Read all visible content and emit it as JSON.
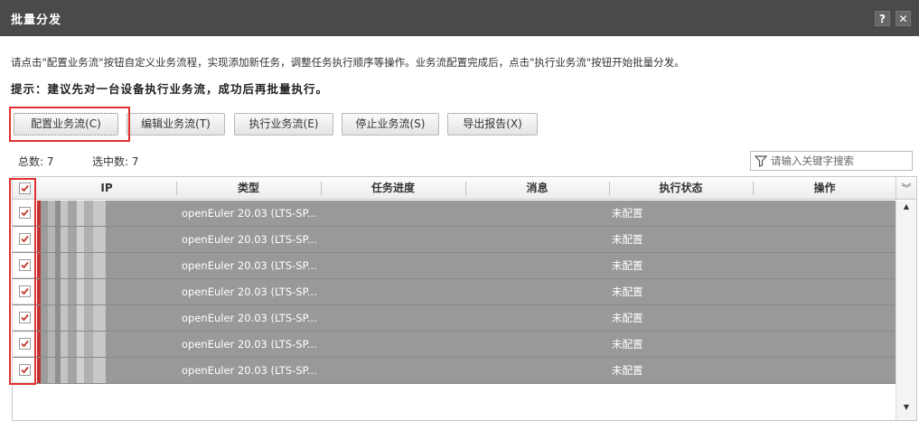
{
  "dialog": {
    "title": "批量分发",
    "help_label": "?",
    "close_label": "✕"
  },
  "instruction": "请点击\"配置业务流\"按钮自定义业务流程，实现添加新任务，调整任务执行顺序等操作。业务流配置完成后，点击\"执行业务流\"按钮开始批量分发。",
  "tip": "提示：建议先对一台设备执行业务流，成功后再批量执行。",
  "toolbar": {
    "config_label": "配置业务流(C)",
    "edit_label": "编辑业务流(T)",
    "execute_label": "执行业务流(E)",
    "stop_label": "停止业务流(S)",
    "export_label": "导出报告(X)"
  },
  "counts": {
    "total": "总数: 7",
    "selected": "选中数: 7"
  },
  "search": {
    "placeholder": "请输入关键字搜索",
    "icon": "filter-icon"
  },
  "table": {
    "columns": [
      "IP",
      "类型",
      "任务进度",
      "消息",
      "执行状态",
      "操作"
    ],
    "header_checked": true,
    "rows": [
      {
        "type": "openEuler 20.03 (LTS-SP...",
        "progress": "",
        "message": "",
        "status": "未配置",
        "checked": true
      },
      {
        "type": "openEuler 20.03 (LTS-SP...",
        "progress": "",
        "message": "",
        "status": "未配置",
        "checked": true
      },
      {
        "type": "openEuler 20.03 (LTS-SP...",
        "progress": "",
        "message": "",
        "status": "未配置",
        "checked": true
      },
      {
        "type": "openEuler 20.03 (LTS-SP...",
        "progress": "",
        "message": "",
        "status": "未配置",
        "checked": true
      },
      {
        "type": "openEuler 20.03 (LTS-SP...",
        "progress": "",
        "message": "",
        "status": "未配置",
        "checked": true
      },
      {
        "type": "openEuler 20.03 (LTS-SP...",
        "progress": "",
        "message": "",
        "status": "未配置",
        "checked": true
      },
      {
        "type": "openEuler 20.03 (LTS-SP...",
        "progress": "",
        "message": "",
        "status": "未配置",
        "checked": true
      }
    ]
  },
  "colors": {
    "titlebar": "#4a4a4a",
    "row_selected": "#999999",
    "highlight": "#e03030",
    "check": "#c0392b"
  }
}
